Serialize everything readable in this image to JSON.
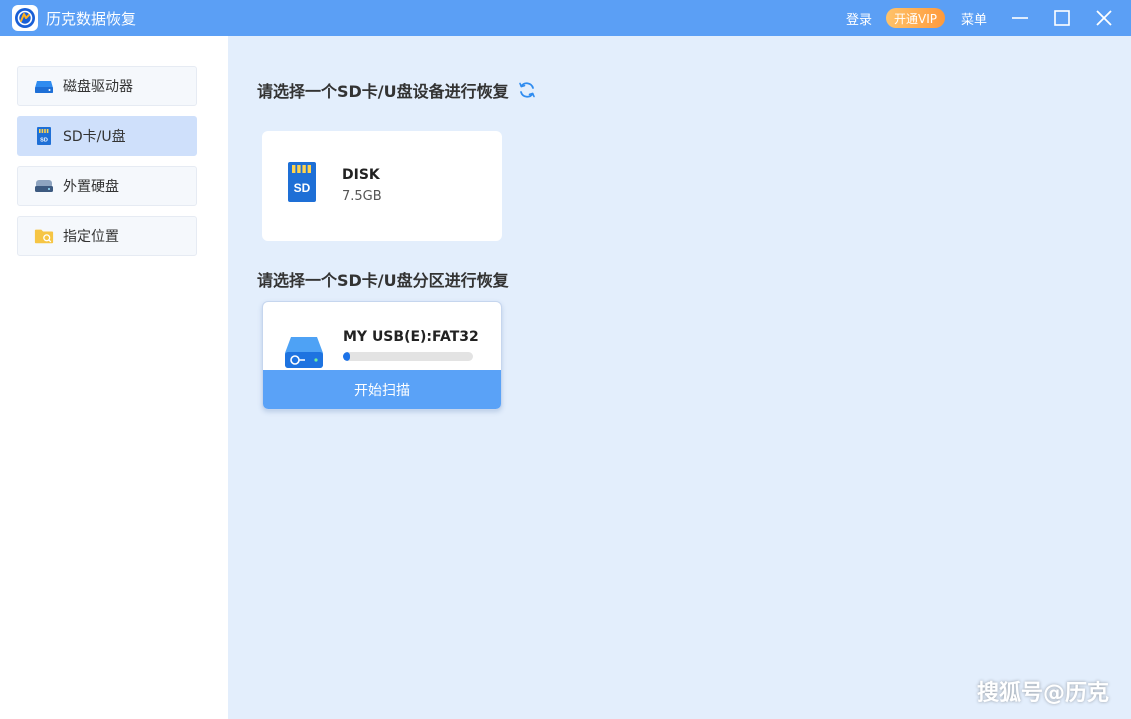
{
  "app": {
    "title": "历克数据恢复"
  },
  "titlebar": {
    "login_label": "登录",
    "vip_label": "开通VIP",
    "menu_label": "菜单"
  },
  "sidebar": {
    "items": [
      {
        "label": "磁盘驱动器",
        "icon": "hard-drive-icon",
        "active": false
      },
      {
        "label": "SD卡/U盘",
        "icon": "sd-card-icon",
        "active": true
      },
      {
        "label": "外置硬盘",
        "icon": "external-drive-icon",
        "active": false
      },
      {
        "label": "指定位置",
        "icon": "folder-icon",
        "active": false
      }
    ]
  },
  "main": {
    "device_section_title": "请选择一个SD卡/U盘设备进行恢复",
    "devices": [
      {
        "name": "DISK",
        "size": "7.5GB",
        "icon": "sd-card-icon"
      }
    ],
    "partition_section_title": "请选择一个SD卡/U盘分区进行恢复",
    "partitions": [
      {
        "name": "MY USB(E):FAT32",
        "usage_percent": 5,
        "icon": "usb-drive-icon",
        "scan_label": "开始扫描"
      }
    ]
  },
  "watermark": "搜狐号@历克",
  "colors": {
    "titlebar": "#5b9ff5",
    "accent": "#1d73e8",
    "scan_button": "#5aa2f7",
    "vip": "#ff9a3c",
    "main_bg": "#e3eefc"
  }
}
